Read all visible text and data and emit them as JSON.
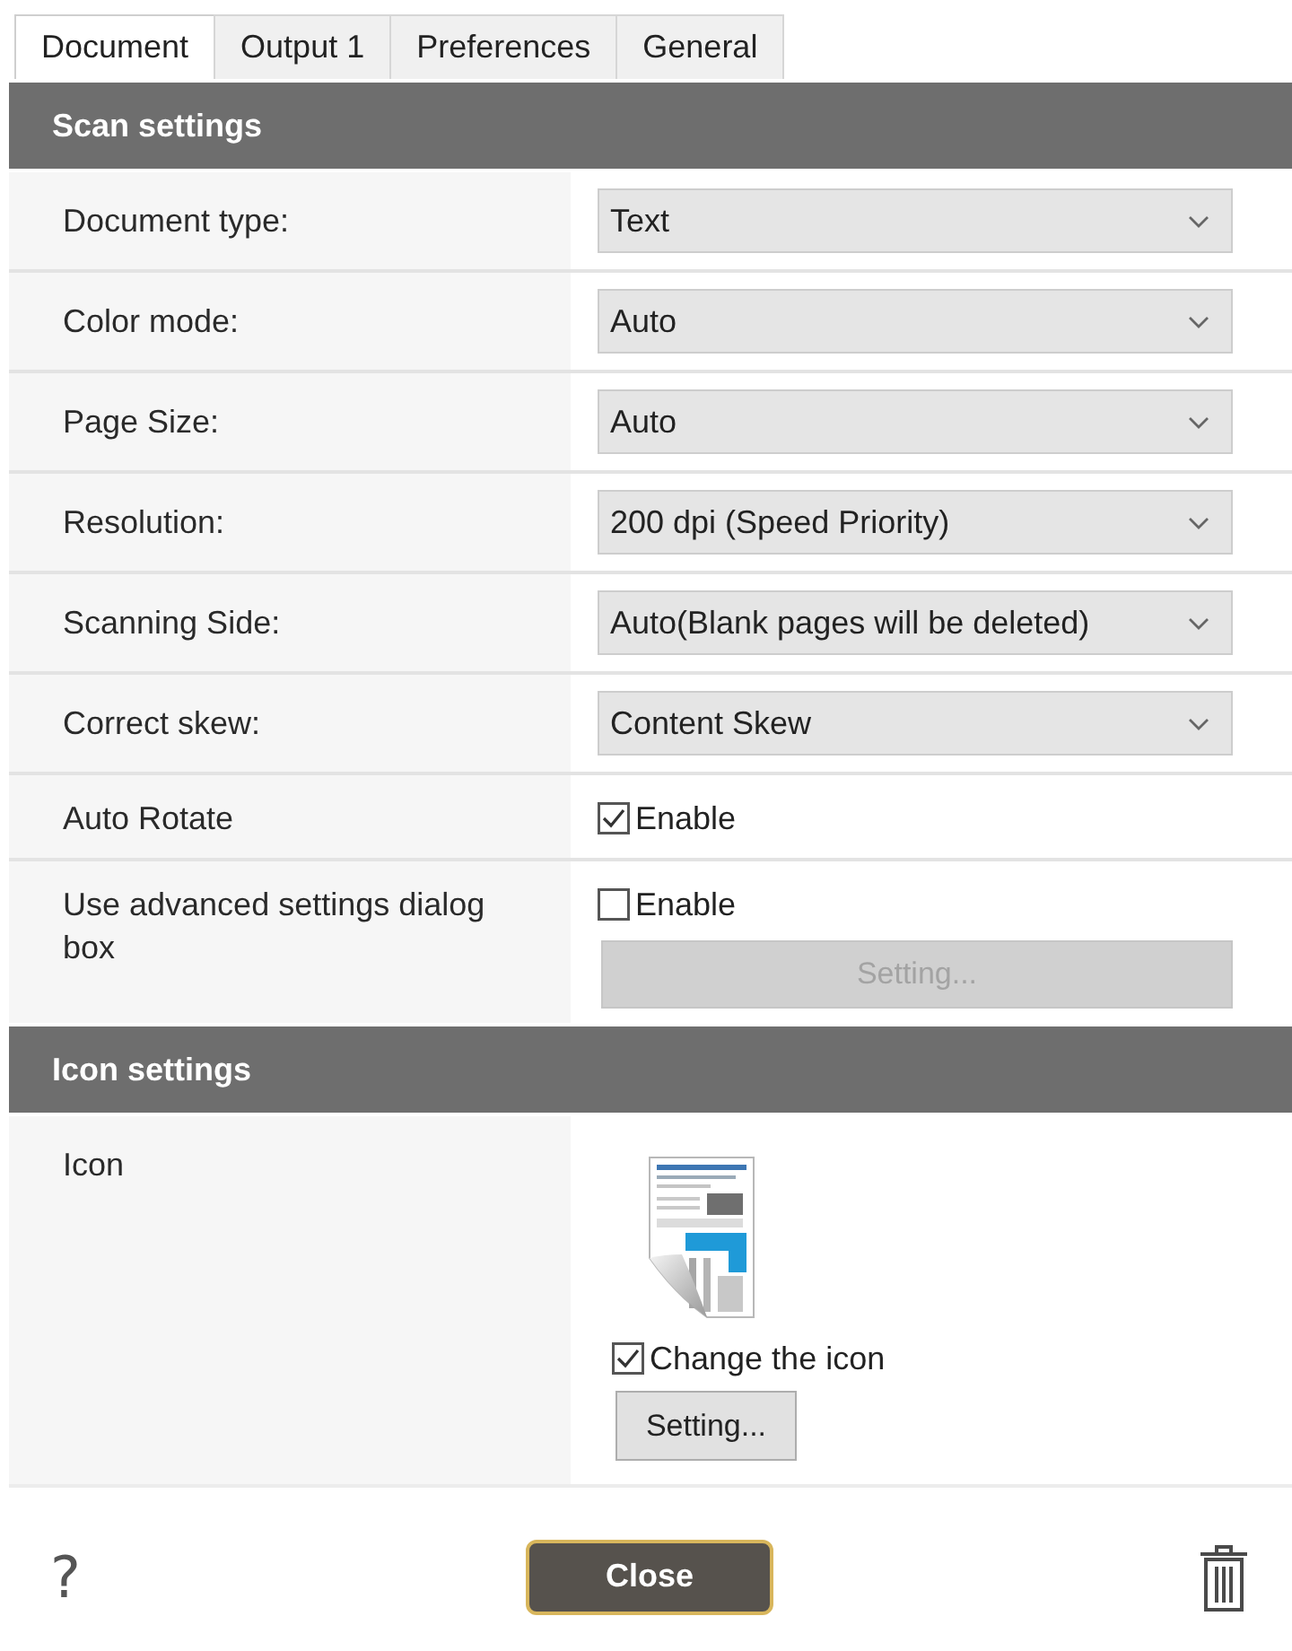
{
  "tabs": [
    {
      "label": "Document",
      "selected": true
    },
    {
      "label": "Output 1",
      "selected": false
    },
    {
      "label": "Preferences",
      "selected": false
    },
    {
      "label": "General",
      "selected": false
    }
  ],
  "sections": [
    {
      "title": "Scan settings",
      "rows": [
        {
          "kind": "dropdown",
          "label": "Document type:",
          "value": "Text"
        },
        {
          "kind": "dropdown",
          "label": "Color mode:",
          "value": "Auto"
        },
        {
          "kind": "dropdown",
          "label": "Page Size:",
          "value": "Auto"
        },
        {
          "kind": "dropdown",
          "label": "Resolution:",
          "value": "200 dpi (Speed Priority)"
        },
        {
          "kind": "dropdown",
          "label": "Scanning Side:",
          "value": "Auto(Blank pages will be deleted)"
        },
        {
          "kind": "dropdown",
          "label": "Correct skew:",
          "value": "Content Skew"
        },
        {
          "kind": "checkbox",
          "label": "Auto Rotate",
          "checkbox": {
            "label": "Enable",
            "checked": true
          }
        },
        {
          "kind": "checkbox",
          "label": "Use advanced settings dialog box",
          "checkbox": {
            "label": "Enable",
            "checked": false
          },
          "button": {
            "label": "Setting...",
            "disabled": true
          }
        }
      ]
    },
    {
      "title": "Icon settings",
      "rows": [
        {
          "kind": "icon",
          "label": "Icon",
          "checkbox": {
            "label": "Change the icon",
            "checked": true
          },
          "button": {
            "label": "Setting...",
            "disabled": false
          }
        }
      ]
    }
  ],
  "footer": {
    "help": "?",
    "close_button": "Close"
  }
}
